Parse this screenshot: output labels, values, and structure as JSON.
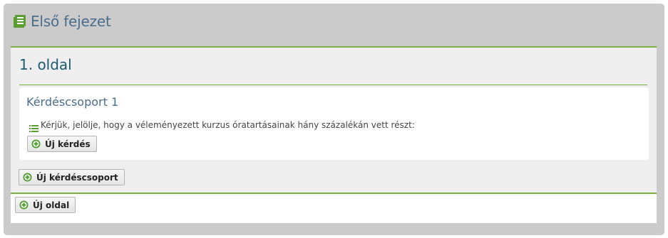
{
  "chapter": {
    "title": "Első fejezet",
    "icon": "book-icon"
  },
  "page": {
    "title": "1. oldal"
  },
  "question_group": {
    "title": "Kérdéscsoport 1",
    "questions": [
      {
        "icon": "list-icon",
        "text": "Kérjük, jelölje, hogy a véleményezett kurzus óratartásainak hány százalékán vett részt:"
      }
    ],
    "new_question_label": "Új kérdés"
  },
  "new_group_label": "Új kérdéscsoport",
  "new_page_label": "Új oldal",
  "colors": {
    "accent_green": "#78b13f",
    "title_blue": "#4a6d8c",
    "page_title_blue": "#1d5a70",
    "background_gray": "#cbcbcb"
  }
}
